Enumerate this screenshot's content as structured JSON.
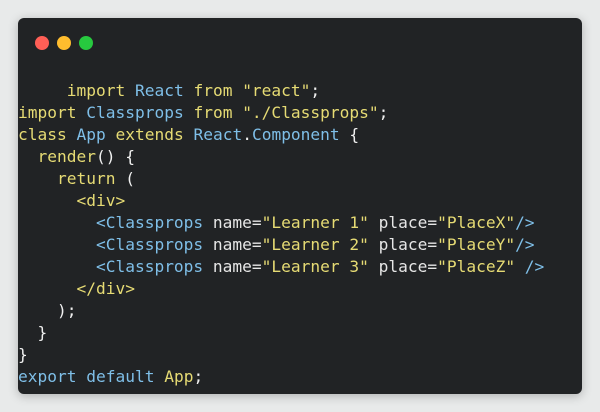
{
  "window": {
    "controls": [
      {
        "name": "close",
        "color": "#ff5f56"
      },
      {
        "name": "minimize",
        "color": "#ffbd2e"
      },
      {
        "name": "maximize",
        "color": "#27c93f"
      }
    ]
  },
  "code": {
    "language": "jsx",
    "lines": [
      [
        {
          "t": "     "
        },
        {
          "t": "import",
          "c": "kw"
        },
        {
          "t": " "
        },
        {
          "t": "React",
          "c": "id"
        },
        {
          "t": " "
        },
        {
          "t": "from",
          "c": "kw"
        },
        {
          "t": " "
        },
        {
          "t": "\"react\"",
          "c": "str"
        },
        {
          "t": ";",
          "c": "punc"
        }
      ],
      [
        {
          "t": "import",
          "c": "kw"
        },
        {
          "t": " "
        },
        {
          "t": "Classprops",
          "c": "id"
        },
        {
          "t": " "
        },
        {
          "t": "from",
          "c": "kw"
        },
        {
          "t": " "
        },
        {
          "t": "\"./Classprops\"",
          "c": "str"
        },
        {
          "t": ";",
          "c": "punc"
        }
      ],
      [
        {
          "t": "class",
          "c": "kw"
        },
        {
          "t": " "
        },
        {
          "t": "App",
          "c": "id"
        },
        {
          "t": " "
        },
        {
          "t": "extends",
          "c": "kw"
        },
        {
          "t": " "
        },
        {
          "t": "React",
          "c": "id"
        },
        {
          "t": ".",
          "c": "punc"
        },
        {
          "t": "Component",
          "c": "id"
        },
        {
          "t": " {",
          "c": "punc"
        }
      ],
      [
        {
          "t": "  "
        },
        {
          "t": "render",
          "c": "kw"
        },
        {
          "t": "() {",
          "c": "punc"
        }
      ],
      [
        {
          "t": "    "
        },
        {
          "t": "return",
          "c": "kw"
        },
        {
          "t": " (",
          "c": "punc"
        }
      ],
      [
        {
          "t": "      "
        },
        {
          "t": "<div>",
          "c": "kw"
        }
      ],
      [
        {
          "t": "        "
        },
        {
          "t": "<Classprops",
          "c": "tag"
        },
        {
          "t": " name=",
          "c": "attr"
        },
        {
          "t": "\"Learner 1\"",
          "c": "str"
        },
        {
          "t": " place=",
          "c": "attr"
        },
        {
          "t": "\"PlaceX\"",
          "c": "str"
        },
        {
          "t": "/>",
          "c": "tag"
        }
      ],
      [
        {
          "t": "        "
        },
        {
          "t": "<Classprops",
          "c": "tag"
        },
        {
          "t": " name=",
          "c": "attr"
        },
        {
          "t": "\"Learner 2\"",
          "c": "str"
        },
        {
          "t": " place=",
          "c": "attr"
        },
        {
          "t": "\"PlaceY\"",
          "c": "str"
        },
        {
          "t": "/>",
          "c": "tag"
        }
      ],
      [
        {
          "t": "        "
        },
        {
          "t": "<Classprops",
          "c": "tag"
        },
        {
          "t": " name=",
          "c": "attr"
        },
        {
          "t": "\"Learner 3\"",
          "c": "str"
        },
        {
          "t": " place=",
          "c": "attr"
        },
        {
          "t": "\"PlaceZ\"",
          "c": "str"
        },
        {
          "t": " />",
          "c": "tag"
        }
      ],
      [
        {
          "t": "      "
        },
        {
          "t": "</div>",
          "c": "kw"
        }
      ],
      [
        {
          "t": "    "
        },
        {
          "t": ");",
          "c": "punc"
        }
      ],
      [
        {
          "t": "  "
        },
        {
          "t": "}",
          "c": "punc"
        }
      ],
      [
        {
          "t": "}",
          "c": "punc"
        }
      ],
      [
        {
          "t": "export",
          "c": "id"
        },
        {
          "t": " "
        },
        {
          "t": "default",
          "c": "id"
        },
        {
          "t": " "
        },
        {
          "t": "App",
          "c": "kw"
        },
        {
          "t": ";",
          "c": "punc"
        }
      ]
    ]
  }
}
